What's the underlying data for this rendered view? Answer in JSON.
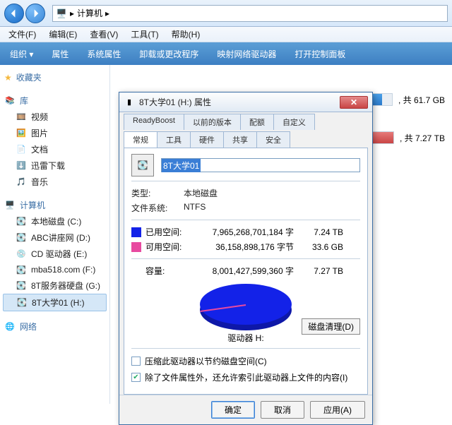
{
  "addressbar": {
    "path": "计算机",
    "sep": "▸"
  },
  "menus": [
    "文件(F)",
    "编辑(E)",
    "查看(V)",
    "工具(T)",
    "帮助(H)"
  ],
  "toolbar": [
    "组织 ▾",
    "属性",
    "系统属性",
    "卸载或更改程序",
    "映射网络驱动器",
    "打开控制面板"
  ],
  "sidebar": {
    "favorites": "收藏夹",
    "libraries": "库",
    "lib_items": [
      "视频",
      "图片",
      "文档",
      "迅雷下载",
      "音乐"
    ],
    "computer": "计算机",
    "drives": [
      "本地磁盘 (C:)",
      "ABC讲座网 (D:)",
      "CD 驱动器 (E:)",
      "mba518.com (F:)",
      "8T服务器硬盘 (G:)",
      "8T大学01 (H:)"
    ],
    "network": "网络"
  },
  "content": {
    "bar1_label": ", 共 61.7 GB",
    "bar2_label": ", 共 7.27 TB"
  },
  "dialog": {
    "title": "8T大学01 (H:) 属性",
    "tabs_row1": [
      "ReadyBoost",
      "以前的版本",
      "配额",
      "自定义"
    ],
    "tabs_row2": [
      "常规",
      "工具",
      "硬件",
      "共享",
      "安全"
    ],
    "drive_name": "8T大学01",
    "type_lbl": "类型:",
    "type_val": "本地磁盘",
    "fs_lbl": "文件系统:",
    "fs_val": "NTFS",
    "used_lbl": "已用空间:",
    "used_bytes": "7,965,268,701,184 字",
    "used_hr": "7.24 TB",
    "free_lbl": "可用空间:",
    "free_bytes": "36,158,898,176 字节",
    "free_hr": "33.6 GB",
    "cap_lbl": "容量:",
    "cap_bytes": "8,001,427,599,360 字",
    "cap_hr": "7.27 TB",
    "pie_label": "驱动器 H:",
    "clean_btn": "磁盘清理(D)",
    "chk1": "压缩此驱动器以节约磁盘空间(C)",
    "chk2": "除了文件属性外，还允许索引此驱动器上文件的内容(I)",
    "ok": "确定",
    "cancel": "取消",
    "apply": "应用(A)"
  },
  "chart_data": {
    "type": "pie",
    "title": "驱动器 H:",
    "series": [
      {
        "name": "已用空间",
        "value": 7965268701184,
        "value_hr": "7.24 TB",
        "color": "#1322e8"
      },
      {
        "name": "可用空间",
        "value": 36158898176,
        "value_hr": "33.6 GB",
        "color": "#e84aa0"
      }
    ],
    "total": 8001427599360,
    "total_hr": "7.27 TB"
  }
}
